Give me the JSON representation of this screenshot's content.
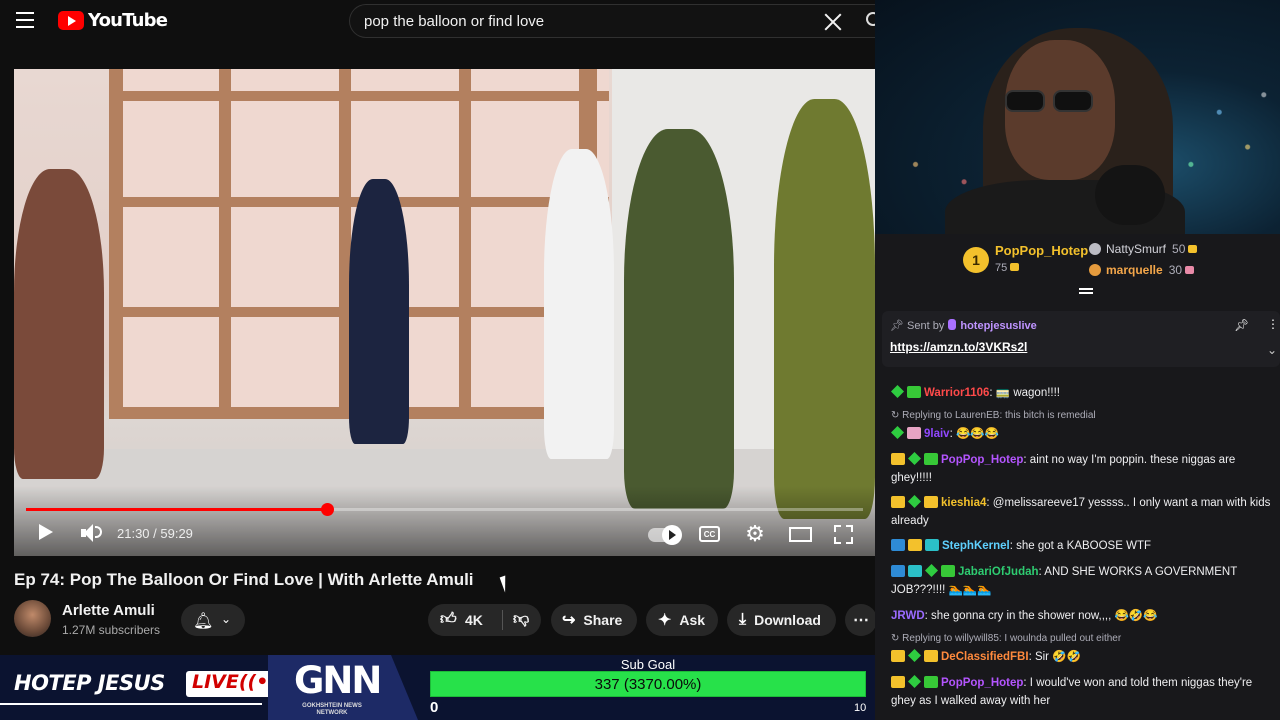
{
  "youtube": {
    "logo_text": "YouTube",
    "search_query": "pop the balloon or find love",
    "player": {
      "time": "21:30 / 59:29",
      "progress_fraction": 0.36,
      "cc_label": "CC"
    },
    "video_title": "Ep 74: Pop The Balloon Or Find Love | With Arlette Amuli",
    "channel": {
      "name": "Arlette Amuli",
      "subscribers": "1.27M subscribers"
    },
    "actions": {
      "likes": "4K",
      "share": "Share",
      "ask": "Ask",
      "download": "Download"
    }
  },
  "stream_bar": {
    "show_name": "HOTEP JESUS",
    "live_label": "LIVE",
    "network_logo": "GNN",
    "network_subtitle": "GOKHSHTEIN NEWS NETWORK",
    "sub_goal": {
      "label": "Sub Goal",
      "text": "337 (3370.00%)",
      "min": "0",
      "max": "10",
      "progress_fraction": 1.0
    }
  },
  "leaderboard": {
    "first": {
      "rank": "1",
      "name": "PopPop_Hotep",
      "points": "75"
    },
    "second": {
      "name": "NattySmurf",
      "points": "50"
    },
    "third": {
      "name": "marquelle",
      "points": "30"
    }
  },
  "pinned": {
    "sent_by_label": "Sent by",
    "sender": "hotepjesuslive",
    "link": "https://amzn.to/3VKRs2l"
  },
  "chat": {
    "messages": [
      {
        "user": "Warrior1106",
        "color": "#ff4a4a",
        "text": ": 🚃 wagon!!!!"
      },
      {
        "reply": "Replying to LaurenEB: this bitch is remedial"
      },
      {
        "user": "9laiv",
        "color": "#9147ff",
        "text": ": 😂😂😂"
      },
      {
        "user": "PopPop_Hotep",
        "color": "#b455ff",
        "text": ": aint no way I'm poppin. these niggas are ghey!!!!!"
      },
      {
        "user": "kieshia4",
        "color": "#f3c12c",
        "text": ": @melissareeve17 yessss.. I only want a man with kids already"
      },
      {
        "user": "StephKernel",
        "color": "#5fd1ff",
        "text": ": she got a KABOOSE WTF"
      },
      {
        "user": "JabariOfJudah",
        "color": "#2ecc71",
        "text": ": AND SHE WORKS A GOVERNMENT JOB???!!!! 🏊🏊🏊"
      },
      {
        "user": "JRWD",
        "color": "#9b6bff",
        "text": ": she gonna cry in the shower now,,,, 😂🤣😂"
      },
      {
        "reply": "Replying to willywill85: I woulnda pulled out either"
      },
      {
        "user": "DeClassifiedFBI",
        "color": "#ff8a3d",
        "text": ": Sir 🤣🤣"
      },
      {
        "user": "PopPop_Hotep",
        "color": "#b455ff",
        "text": ": I would've won and told them niggas they're ghey as I walked away with her"
      }
    ]
  },
  "colors": {
    "youtube_red": "#ff0000",
    "chat_bg": "#18181b",
    "goal_green": "#27e14a",
    "stream_bar_bg": "#0b1330"
  }
}
